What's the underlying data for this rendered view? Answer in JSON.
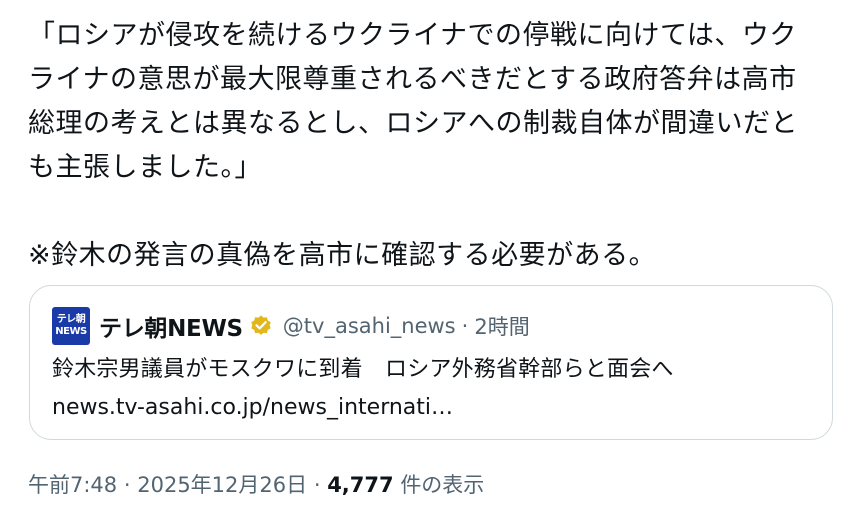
{
  "tweet": {
    "lines": [
      "「ロシアが侵攻を続けるウクライナでの停戦に向けては、ウク",
      "ライナの意思が最大限尊重されるべきだとする政府答弁は高市",
      "総理の考えとは異なるとし、ロシアへの制裁自体が間違いだと",
      "も主張しました。」",
      "※鈴木の発言の真偽を高市に確認する必要がある。"
    ]
  },
  "quote": {
    "avatar_text_1": "テレ朝",
    "avatar_text_2": "NEWS",
    "source_name": "テレ朝NEWS",
    "handle": "@tv_asahi_news",
    "separator": "·",
    "time": "2時間",
    "text": "鈴木宗男議員がモスクワに到着　ロシア外務省幹部らと面会へ",
    "link": "news.tv-asahi.co.jp/news_internati…"
  },
  "meta": {
    "time": "午前7:48",
    "separator": "·",
    "date": "2025年12月26日",
    "views_count": "4,777",
    "views_label": "件の表示"
  },
  "colors": {
    "text": "#0f1419",
    "secondary": "#536471",
    "border": "#cfd9de",
    "badge": "#e2b719",
    "avatar": "#1a3aa8"
  },
  "icons": {
    "verified": "verified-badge-icon"
  }
}
